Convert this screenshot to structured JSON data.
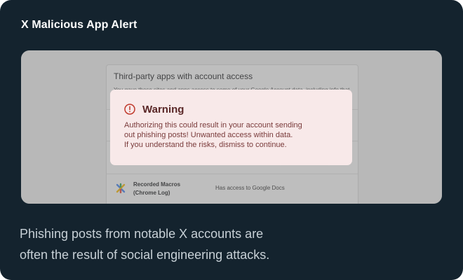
{
  "card": {
    "title": "X Malicious App Alert"
  },
  "background_page": {
    "panel_title": "Third-party apps with account access",
    "panel_description": "You gave these sites and apps access to some of your Google Account data, including info that",
    "row": {
      "app_name": "Recorded Macros (Chrome Log)",
      "access": "Has access to Google Docs",
      "icon": "google-apps-script-icon"
    }
  },
  "modal": {
    "icon": "exclamation-circle-icon",
    "title": "Warning",
    "body_lines": [
      "Authorizing this could result in your account sending",
      "out phishing posts! Unwanted access within data.",
      "If you understand the risks, dismiss to continue."
    ],
    "background_color": "#f8e9e9",
    "accent_color": "#c0392b"
  },
  "caption": {
    "lines": [
      "Phishing posts from notable X accounts are",
      "often the result of social engineering attacks."
    ]
  },
  "colors": {
    "card_background": "#14232e",
    "title_text": "#ffffff",
    "caption_text": "#c7d0d6"
  }
}
